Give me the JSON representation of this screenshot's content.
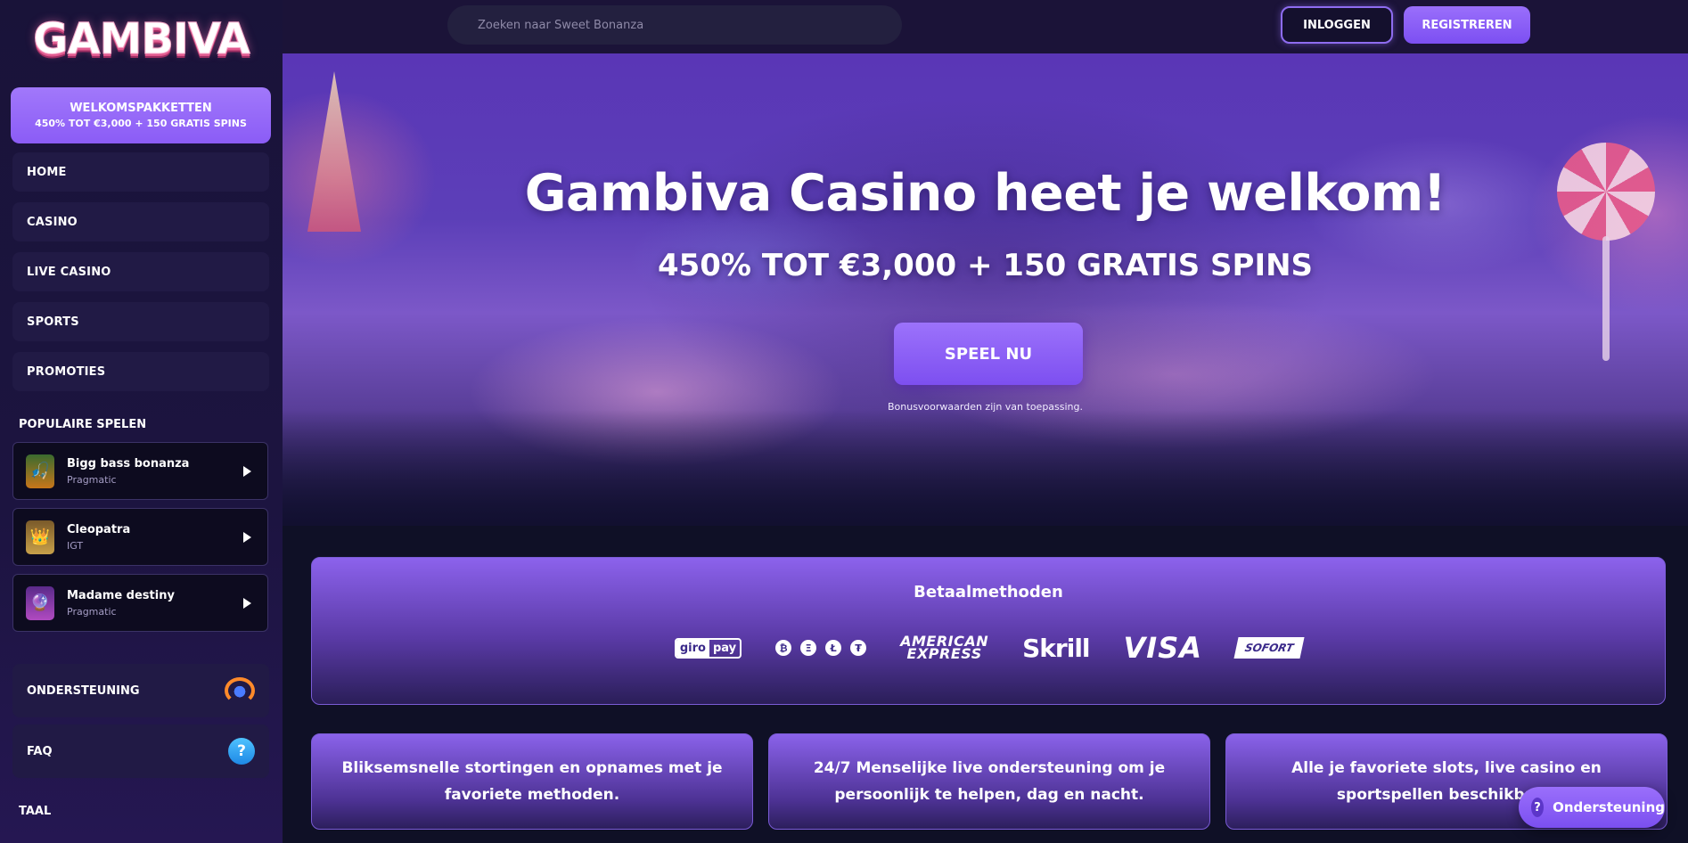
{
  "brand": {
    "logo": "GAMBIVA",
    "accent": "#8b5cf6"
  },
  "sidebar": {
    "welcome": {
      "line1": "WELKOMSPAKKETTEN",
      "line2": "450% TOT €3,000 + 150 GRATIS SPINS"
    },
    "nav": [
      {
        "label": "HOME"
      },
      {
        "label": "CASINO"
      },
      {
        "label": "LIVE CASINO"
      },
      {
        "label": "SPORTS"
      },
      {
        "label": "PROMOTIES"
      }
    ],
    "popular_title": "POPULAIRE SPELEN",
    "games": [
      {
        "name": "Bigg bass bonanza",
        "provider": "Pragmatic"
      },
      {
        "name": "Cleopatra",
        "provider": "IGT"
      },
      {
        "name": "Madame destiny",
        "provider": "Pragmatic"
      }
    ],
    "support": {
      "label": "ONDERSTEUNING",
      "icon": "headset-icon"
    },
    "faq": {
      "label": "FAQ",
      "icon": "help-icon"
    },
    "language_title": "TAAL"
  },
  "header": {
    "search_placeholder": "Zoeken naar Sweet Bonanza",
    "login_label": "INLOGGEN",
    "register_label": "REGISTREREN"
  },
  "hero": {
    "title": "Gambiva Casino heet je welkom!",
    "subtitle": "450% TOT €3,000 + 150 GRATIS SPINS",
    "cta_label": "SPEEL NU",
    "note": "Bonusvoorwaarden zijn van toepassing."
  },
  "payments": {
    "title": "Betaalmethoden",
    "methods": [
      "giropay",
      "crypto",
      "American Express",
      "Skrill",
      "VISA",
      "SOFORT"
    ],
    "giropay": {
      "part1": "giro",
      "part2": "pay"
    },
    "crypto": [
      "₿",
      "Ξ",
      "Ł",
      "₮"
    ],
    "amex": {
      "line1": "AMERICAN",
      "line2": "EXPRESS"
    },
    "skrill": "Skrill",
    "visa": "VISA",
    "sofort": "SOFORT"
  },
  "features": [
    {
      "text": "Bliksemsnelle stortingen en opnames met je favoriete methoden."
    },
    {
      "text": "24/7 Menselijke live ondersteuning om je persoonlijk te helpen, dag en nacht."
    },
    {
      "text": "Alle je favoriete slots, live casino en sportspellen beschikbaar."
    }
  ],
  "fab": {
    "label": "Ondersteuning",
    "icon_glyph": "?"
  }
}
